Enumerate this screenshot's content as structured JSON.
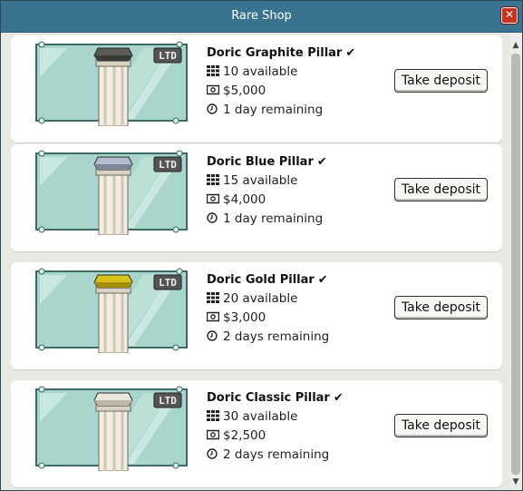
{
  "window": {
    "title": "Rare Shop"
  },
  "colors": {
    "titlebar": "#3a7390",
    "close": "#c8321f",
    "glass": "#a9d6cc",
    "background": "#e9e9e4"
  },
  "items": [
    {
      "name": "Doric Graphite Pillar",
      "available": "10 available",
      "price": "$5,000",
      "remaining": "1 day remaining",
      "button": "Take deposit",
      "cap_color": "#5b5b58",
      "cap_shade": "#3a3a38",
      "badge": "LTD"
    },
    {
      "name": "Doric Blue Pillar",
      "available": "15 available",
      "price": "$4,000",
      "remaining": "1 day remaining",
      "button": "Take deposit",
      "cap_color": "#b4bccb",
      "cap_shade": "#7f889a",
      "badge": "LTD"
    },
    {
      "name": "Doric Gold Pillar",
      "available": "20 available",
      "price": "$3,000",
      "remaining": "2 days remaining",
      "button": "Take deposit",
      "cap_color": "#d8c21a",
      "cap_shade": "#a38e06",
      "badge": "LTD"
    },
    {
      "name": "Doric Classic Pillar",
      "available": "30 available",
      "price": "$2,500",
      "remaining": "2 days remaining",
      "button": "Take deposit",
      "cap_color": "#ece8de",
      "cap_shade": "#bdb7a8",
      "badge": "LTD"
    }
  ]
}
